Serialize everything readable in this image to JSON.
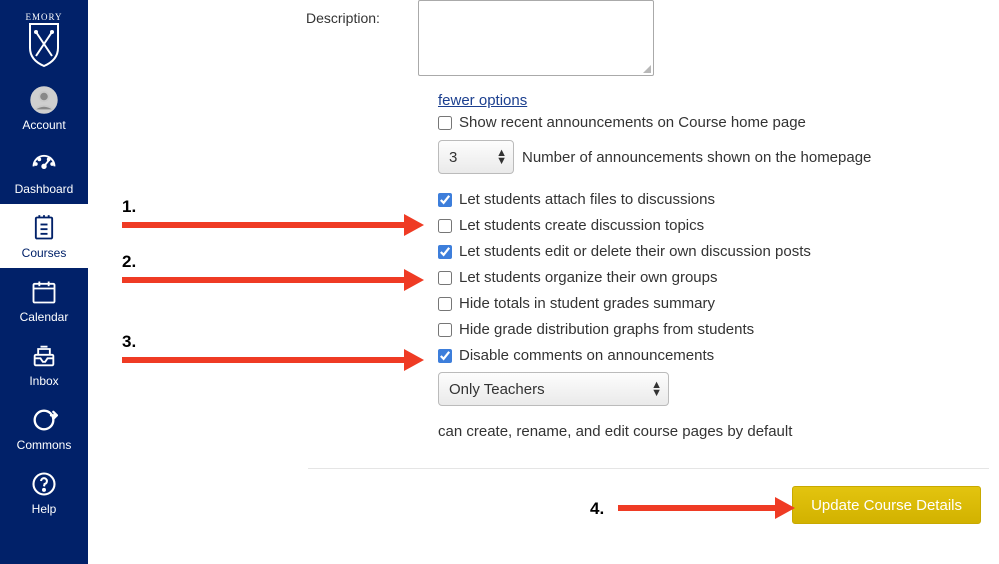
{
  "sidebar": {
    "brand": "EMORY",
    "items": [
      {
        "label": "Account"
      },
      {
        "label": "Dashboard"
      },
      {
        "label": "Courses"
      },
      {
        "label": "Calendar"
      },
      {
        "label": "Inbox"
      },
      {
        "label": "Commons"
      },
      {
        "label": "Help"
      }
    ]
  },
  "form": {
    "description_label": "Description:",
    "description_value": "",
    "fewer_options": "fewer options",
    "opt_recent_ann": "Show recent announcements on Course home page",
    "num_ann_value": "3",
    "num_ann_label": "Number of announcements shown on the homepage",
    "opt_attach": "Let students attach files to discussions",
    "opt_create_topics": "Let students create discussion topics",
    "opt_edit_delete": "Let students edit or delete their own discussion posts",
    "opt_organize_groups": "Let students organize their own groups",
    "opt_hide_totals": "Hide totals in student grades summary",
    "opt_hide_dist": "Hide grade distribution graphs from students",
    "opt_disable_comments": "Disable comments on announcements",
    "who_can_edit_value": "Only Teachers",
    "who_can_edit_suffix": "can create, rename, and edit course pages by default",
    "update_button": "Update Course Details"
  },
  "annotations": {
    "n1": "1.",
    "n2": "2.",
    "n3": "3.",
    "n4": "4."
  }
}
